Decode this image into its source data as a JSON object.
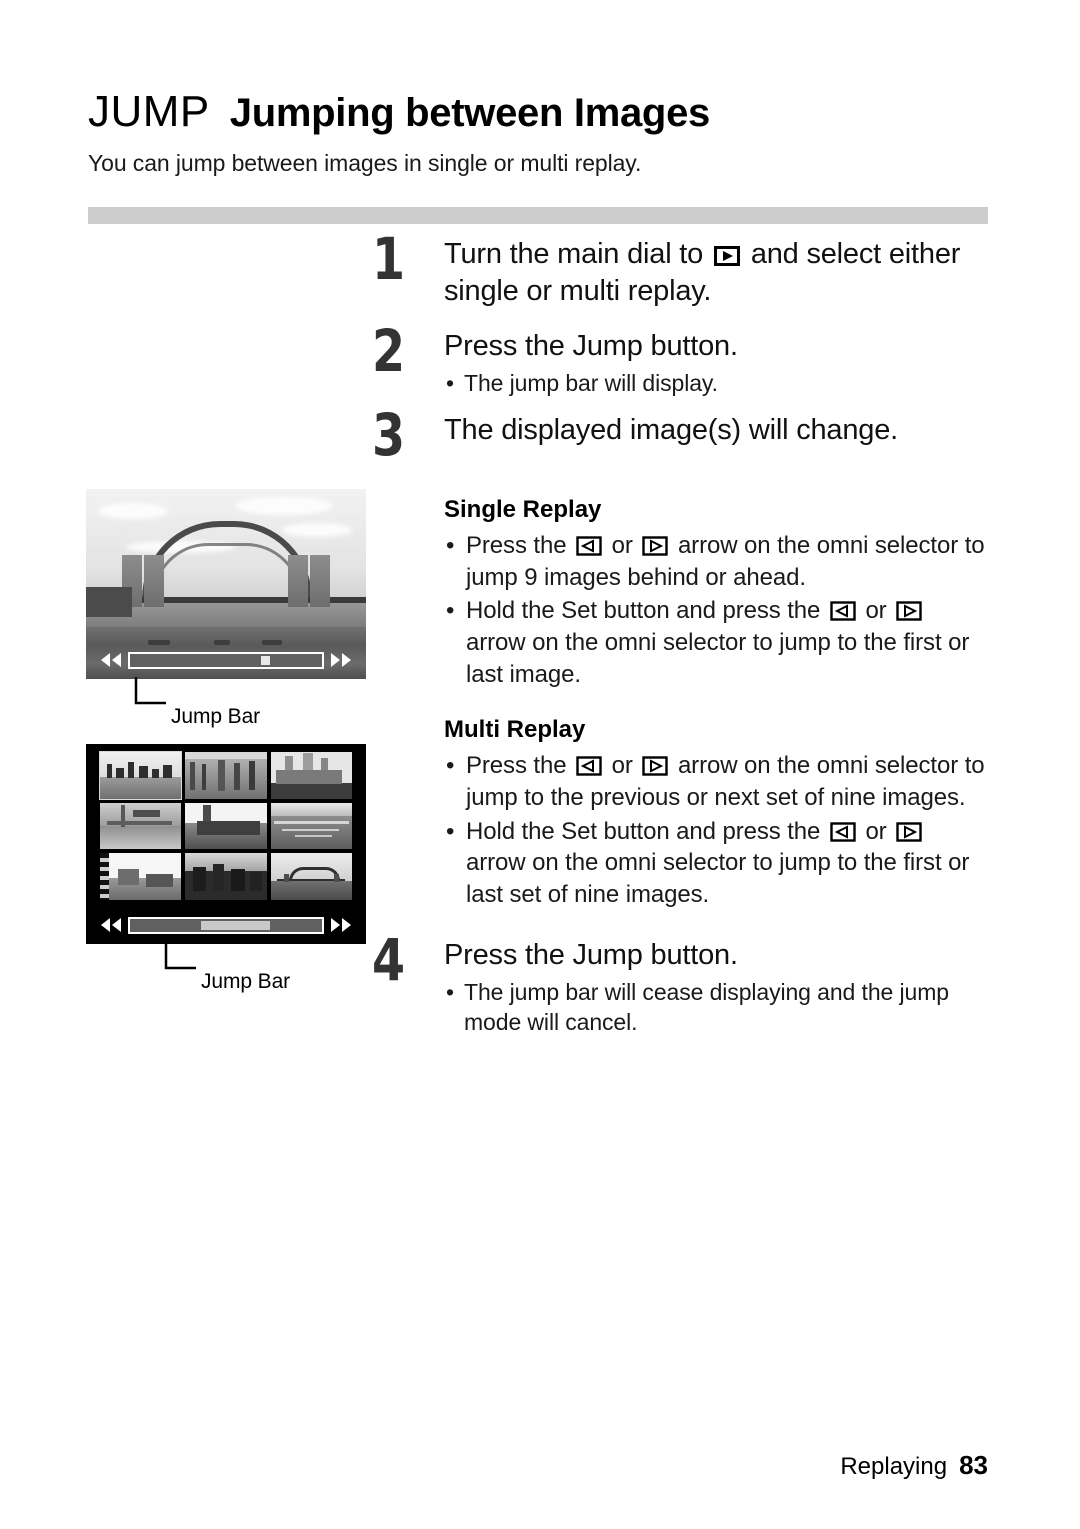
{
  "header": {
    "badge": "JUMP",
    "title": "Jumping between Images",
    "subtitle": "You can jump between images in single or multi replay."
  },
  "steps": [
    {
      "number": "1",
      "title_before": "Turn the main dial to",
      "icon": "play-mode-icon",
      "title_after": "and select either single or multi replay.",
      "bullets": []
    },
    {
      "number": "2",
      "title": "Press the Jump button.",
      "bullets": [
        "The jump bar will display."
      ]
    },
    {
      "number": "3",
      "title": "The displayed image(s) will change.",
      "bullets": []
    },
    {
      "number": "4",
      "title": "Press the Jump button.",
      "bullets": [
        "The jump bar will cease displaying and the jump mode will cancel."
      ]
    }
  ],
  "sections": [
    {
      "heading": "Single Replay",
      "bullets": [
        {
          "part1": "Press the",
          "icon1": "arrow-left-icon",
          "mid": "or",
          "icon2": "arrow-right-icon",
          "part2": "arrow on the omni selector to jump 9 images behind or ahead."
        },
        {
          "part1": "Hold the Set button and press the",
          "icon1": "arrow-left-icon",
          "mid": "or",
          "icon2": "arrow-right-icon",
          "part2": "arrow on the omni selector to jump to the first or last image."
        }
      ]
    },
    {
      "heading": "Multi Replay",
      "bullets": [
        {
          "part1": "Press the",
          "icon1": "arrow-left-icon",
          "mid": "or",
          "icon2": "arrow-right-icon",
          "part2": "arrow on the omni selector to jump to the previous or next set of nine images."
        },
        {
          "part1": "Hold the Set button and press the",
          "icon1": "arrow-left-icon",
          "mid": "or",
          "icon2": "arrow-right-icon",
          "part2": "arrow on the omni selector to jump to the first or last set of nine images."
        }
      ]
    }
  ],
  "illustrations": [
    {
      "id": "single-replay-screen",
      "caption": "Jump Bar",
      "scene": "harbour-bridge-photo"
    },
    {
      "id": "multi-replay-screen",
      "caption": "Jump Bar",
      "scene": "nine-image-thumbnail-grid"
    }
  ],
  "footer": {
    "section": "Replaying",
    "page": "83"
  },
  "colors": {
    "divider": "#cccccc",
    "step_number": "#333333",
    "text": "#000000",
    "screen_background": "#000000"
  }
}
